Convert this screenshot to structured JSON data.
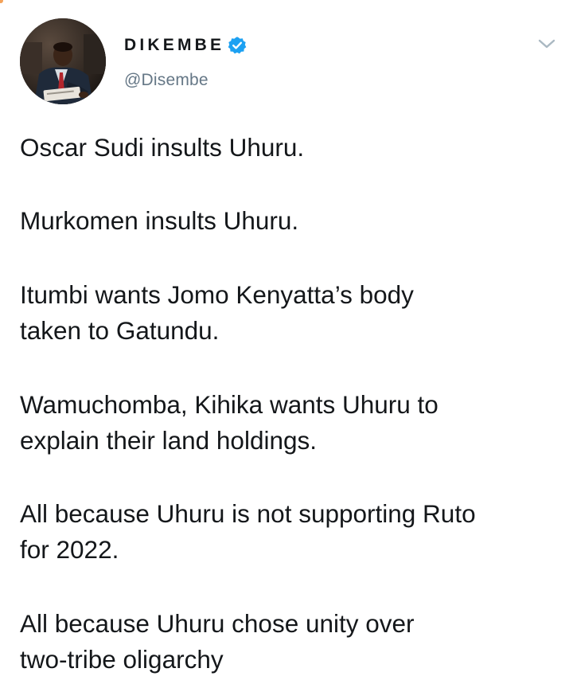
{
  "user": {
    "display_name": "DIKEMBE",
    "handle": "@Disembe",
    "verified": true,
    "avatar_icon": "profile-photo",
    "verified_icon": "verified-badge-icon",
    "menu_icon": "chevron-down-icon"
  },
  "tweet": {
    "paragraphs": [
      [
        "Oscar Sudi insults Uhuru."
      ],
      [
        "Murkomen insults Uhuru."
      ],
      [
        "Itumbi wants Jomo Kenyatta’s body",
        "taken to Gatundu."
      ],
      [
        "Wamuchomba, Kihika wants Uhuru to",
        "explain their land holdings."
      ],
      [
        "All because Uhuru is not supporting Ruto",
        "for 2022."
      ],
      [
        "All because Uhuru chose unity over",
        "two-tribe oligarchy"
      ]
    ]
  },
  "colors": {
    "text": "#14171a",
    "secondary_text": "#657786",
    "verified_blue": "#1da1f2",
    "chevron": "#aab8c2"
  }
}
